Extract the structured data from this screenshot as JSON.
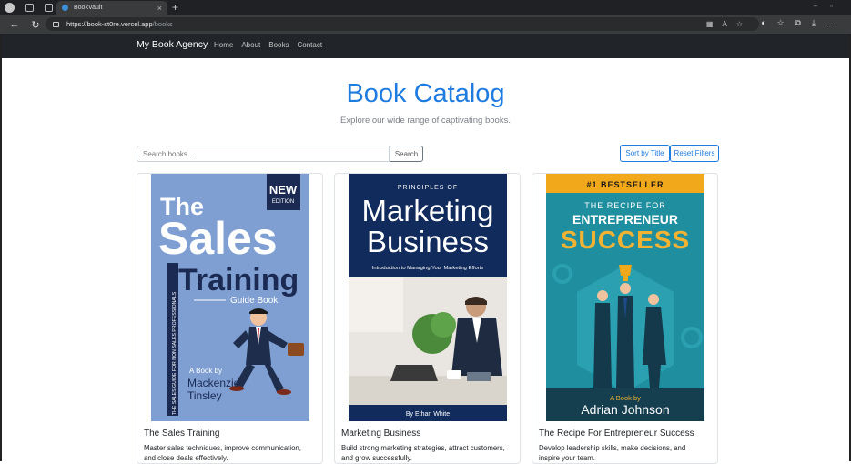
{
  "browser": {
    "tab_title": "BookVault",
    "url_host": "https://book-st0re.vercel.app",
    "url_path": "/books",
    "tab_close": "×",
    "new_tab": "+"
  },
  "navbar": {
    "brand": "My Book Agency",
    "links": [
      "Home",
      "About",
      "Books",
      "Contact"
    ]
  },
  "header": {
    "title": "Book Catalog",
    "subtitle": "Explore our wide range of captivating books."
  },
  "toolbar": {
    "search_placeholder": "Search books...",
    "search_label": "Search",
    "sort_label": "Sort by Title",
    "reset_label": "Reset Filters"
  },
  "books": [
    {
      "title": "The Sales Training",
      "description": "Master sales techniques, improve communication, and close deals effectively.",
      "cover": {
        "badge1": "NEW",
        "badge2": "EDITION",
        "line1": "The",
        "line2": "Sales",
        "line3": "Training",
        "line4": "Guide Book",
        "spine": "THE SALES GUIDE FOR NON SALES PROFESSIONALS",
        "by": "A Book by",
        "author1": "Mackenzie",
        "author2": "Tinsley"
      }
    },
    {
      "title": "Marketing Business",
      "description": "Build strong marketing strategies, attract customers, and grow successfully.",
      "cover": {
        "top": "PRINCIPLES OF",
        "line1": "Marketing",
        "line2": "Business",
        "tagline": "Introduction to Managing Your Marketing Efforts",
        "author": "By Ethan White"
      }
    },
    {
      "title": "The Recipe For Entrepreneur Success",
      "description": "Develop leadership skills, make decisions, and inspire your team.",
      "cover": {
        "ribbon": "#1 BESTSELLER",
        "line1": "THE RECIPE FOR",
        "line2": "ENTREPRENEUR",
        "line3": "SUCCESS",
        "by": "A Book by",
        "author": "Adrian Johnson"
      }
    }
  ],
  "colors": {
    "accent": "#1e7be0",
    "navbar": "#212529"
  }
}
